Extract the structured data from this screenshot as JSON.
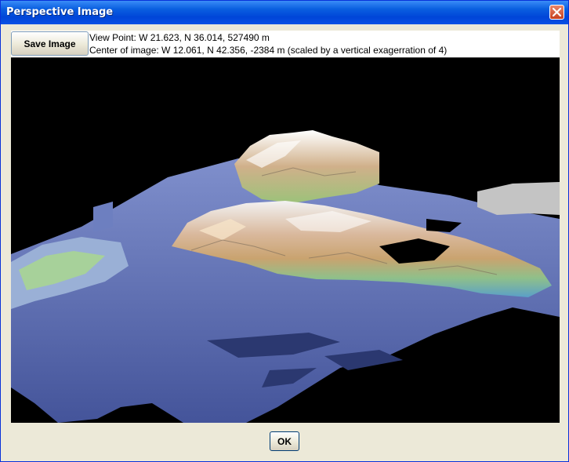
{
  "window": {
    "title": "Perspective Image"
  },
  "toolbar": {
    "save_label": "Save Image",
    "view_point": "View Point: W 21.623, N 36.014, 527490 m",
    "center_of_image": "Center of image: W 12.061, N 42.356, -2384 m (scaled by a vertical exagerration of 4)"
  },
  "footer": {
    "ok_label": "OK"
  },
  "colors": {
    "title_bar": "#0a5fe0",
    "dialog_bg": "#ece9d8",
    "terrain_low": "#5e73b4",
    "terrain_mid": "#c79a7a",
    "terrain_high": "#e6e6e6"
  }
}
